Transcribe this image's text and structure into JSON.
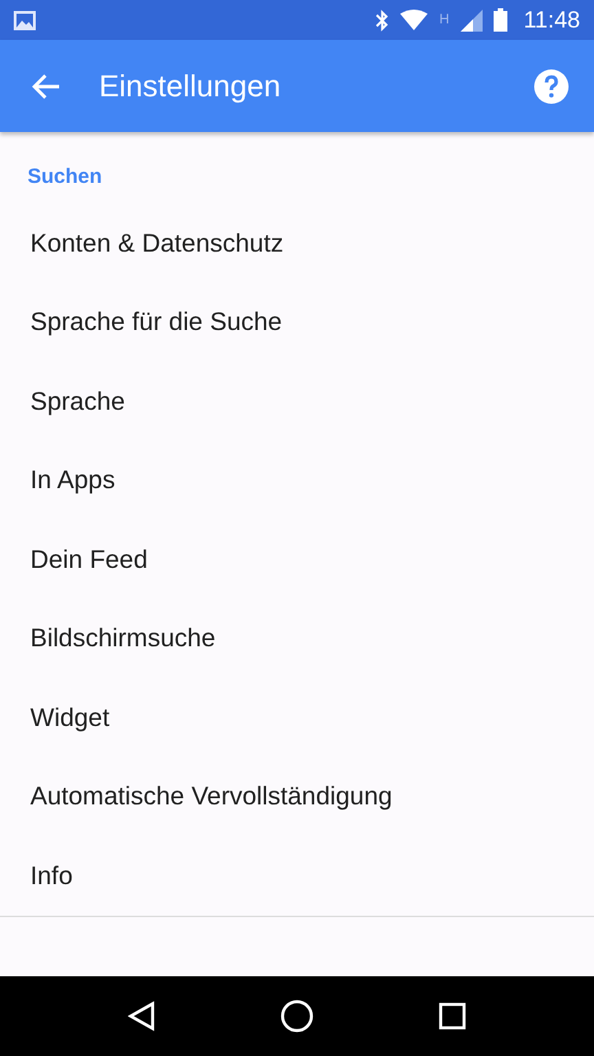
{
  "status_bar": {
    "network": "H",
    "time": "11:48"
  },
  "app_bar": {
    "title": "Einstellungen"
  },
  "section": {
    "title": "Suchen"
  },
  "items": [
    {
      "label": "Konten & Datenschutz"
    },
    {
      "label": "Sprache für die Suche"
    },
    {
      "label": "Sprache"
    },
    {
      "label": "In Apps"
    },
    {
      "label": "Dein Feed"
    },
    {
      "label": "Bildschirmsuche"
    },
    {
      "label": "Widget"
    },
    {
      "label": "Automatische Vervollständigung"
    },
    {
      "label": "Info"
    }
  ]
}
